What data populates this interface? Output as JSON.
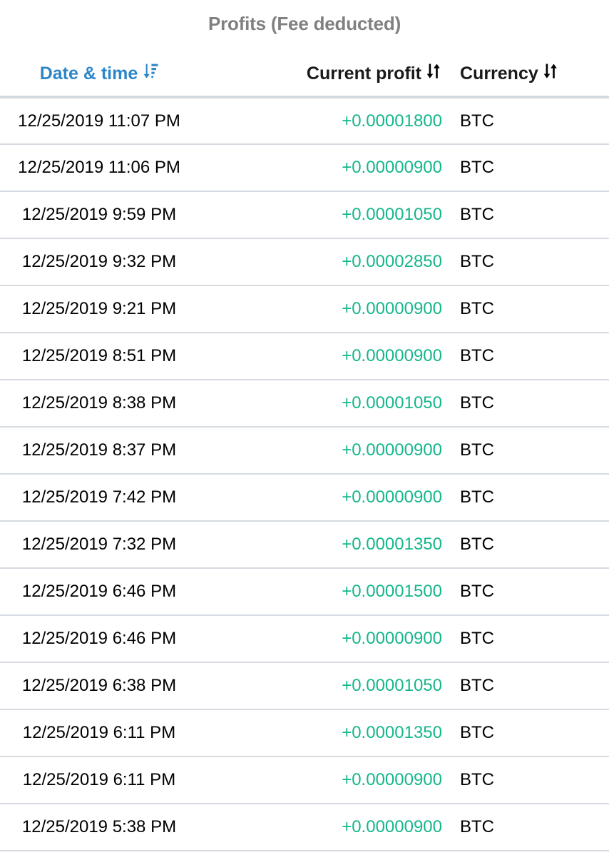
{
  "panel": {
    "title": "Profits (Fee deducted)"
  },
  "colors": {
    "title_gray": "#808080",
    "active_sort_blue": "#2d86c9",
    "profit_green": "#14b68b",
    "row_divider": "#d5dbe0",
    "header_divider": "#d3dbe0",
    "text_black": "#000000"
  },
  "table": {
    "columns": [
      {
        "key": "date",
        "label": "Date & time",
        "sort_icon": "sort-amount-down-icon",
        "sort_state": "descending",
        "active": true
      },
      {
        "key": "profit",
        "label": "Current profit",
        "sort_icon": "sort-updown-icon",
        "sort_state": "unsorted",
        "active": false
      },
      {
        "key": "currency",
        "label": "Currency",
        "sort_icon": "sort-updown-icon",
        "sort_state": "unsorted",
        "active": false
      }
    ],
    "rows": [
      {
        "date": "12/25/2019 11:07 PM",
        "profit": "+0.00001800",
        "currency": "BTC"
      },
      {
        "date": "12/25/2019 11:06 PM",
        "profit": "+0.00000900",
        "currency": "BTC"
      },
      {
        "date": "12/25/2019 9:59 PM",
        "profit": "+0.00001050",
        "currency": "BTC"
      },
      {
        "date": "12/25/2019 9:32 PM",
        "profit": "+0.00002850",
        "currency": "BTC"
      },
      {
        "date": "12/25/2019 9:21 PM",
        "profit": "+0.00000900",
        "currency": "BTC"
      },
      {
        "date": "12/25/2019 8:51 PM",
        "profit": "+0.00000900",
        "currency": "BTC"
      },
      {
        "date": "12/25/2019 8:38 PM",
        "profit": "+0.00001050",
        "currency": "BTC"
      },
      {
        "date": "12/25/2019 8:37 PM",
        "profit": "+0.00000900",
        "currency": "BTC"
      },
      {
        "date": "12/25/2019 7:42 PM",
        "profit": "+0.00000900",
        "currency": "BTC"
      },
      {
        "date": "12/25/2019 7:32 PM",
        "profit": "+0.00001350",
        "currency": "BTC"
      },
      {
        "date": "12/25/2019 6:46 PM",
        "profit": "+0.00001500",
        "currency": "BTC"
      },
      {
        "date": "12/25/2019 6:46 PM",
        "profit": "+0.00000900",
        "currency": "BTC"
      },
      {
        "date": "12/25/2019 6:38 PM",
        "profit": "+0.00001050",
        "currency": "BTC"
      },
      {
        "date": "12/25/2019 6:11 PM",
        "profit": "+0.00001350",
        "currency": "BTC"
      },
      {
        "date": "12/25/2019 6:11 PM",
        "profit": "+0.00000900",
        "currency": "BTC"
      },
      {
        "date": "12/25/2019 5:38 PM",
        "profit": "+0.00000900",
        "currency": "BTC"
      }
    ]
  }
}
